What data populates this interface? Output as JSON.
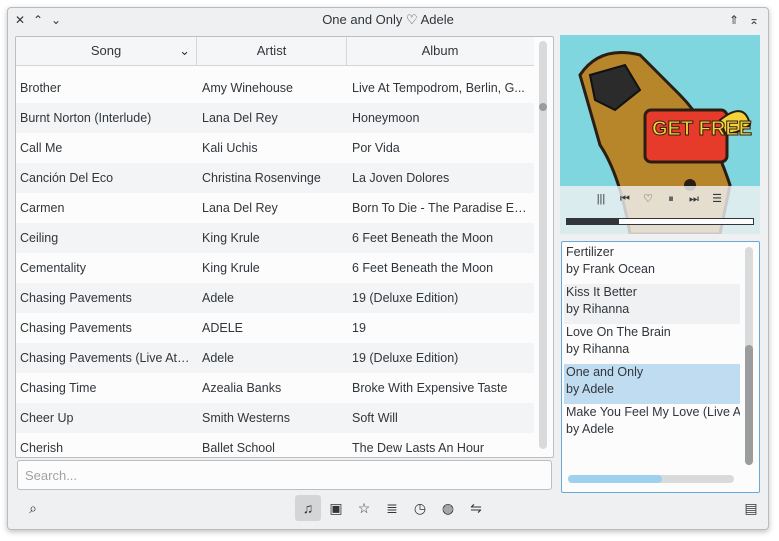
{
  "window": {
    "title": "One and Only ♡ Adele"
  },
  "titlebar": {
    "close": "✕",
    "up": "⌃",
    "down": "⌄",
    "keep_above": "⇑",
    "minimize_up": "⌅"
  },
  "table": {
    "columns": [
      "Song",
      "Artist",
      "Album"
    ],
    "sort_indicator": "⌄",
    "rows": [
      {
        "song": "Brother",
        "artist": "Amy Winehouse",
        "album": "Live At Tempodrom, Berlin, G..."
      },
      {
        "song": "Burnt Norton (Interlude)",
        "artist": "Lana Del Rey",
        "album": "Honeymoon"
      },
      {
        "song": "Call Me",
        "artist": "Kali Uchis",
        "album": "Por Vida"
      },
      {
        "song": "Canción Del Eco",
        "artist": "Christina Rosenvinge",
        "album": "La Joven Dolores"
      },
      {
        "song": "Carmen",
        "artist": "Lana Del Rey",
        "album": "Born To Die - The Paradise Ed..."
      },
      {
        "song": "Ceiling",
        "artist": "King Krule",
        "album": "6 Feet Beneath the Moon"
      },
      {
        "song": "Cementality",
        "artist": "King Krule",
        "album": "6 Feet Beneath the Moon"
      },
      {
        "song": "Chasing Pavements",
        "artist": "Adele",
        "album": "19 (Deluxe Edition)"
      },
      {
        "song": "Chasing Pavements",
        "artist": "ADELE",
        "album": "19"
      },
      {
        "song": "Chasing Pavements (Live At ...",
        "artist": "Adele",
        "album": "19 (Deluxe Edition)"
      },
      {
        "song": "Chasing Time",
        "artist": "Azealia Banks",
        "album": "Broke With Expensive Taste"
      },
      {
        "song": "Cheer Up",
        "artist": "Smith Westerns",
        "album": "Soft Will"
      },
      {
        "song": "Cherish",
        "artist": "Ballet School",
        "album": "The Dew Lasts An Hour"
      }
    ]
  },
  "search": {
    "placeholder": "Search..."
  },
  "bottom_bar": {
    "search_icon": "⌕",
    "music_icon": "♫",
    "album_icon": "▣",
    "star_icon": "☆",
    "playlist_icon": "≣",
    "history_icon": "◷",
    "globe_icon": "◍",
    "settings_icon": "⇋",
    "notes_icon": "▤"
  },
  "player": {
    "art_text": "GET FREE",
    "progress": 0.28,
    "controls": {
      "visualizer": "|||",
      "prev": "⏮",
      "love": "♡",
      "pause": "⏸",
      "next": "⏭",
      "queue": "☰"
    }
  },
  "playlist": {
    "items": [
      {
        "title": "Fertilizer",
        "artist": "by Frank Ocean"
      },
      {
        "title": "Kiss It Better",
        "artist": "by Rihanna"
      },
      {
        "title": "Love On The Brain",
        "artist": "by Rihanna"
      },
      {
        "title": "One and Only",
        "artist": "by Adele"
      },
      {
        "title": "Make You Feel My Love (Live At",
        "artist": "by Adele"
      }
    ],
    "selected_index": 3
  },
  "colors": {
    "selection": "#bfdcf0",
    "accent": "#3daee9",
    "art_bg": "#7fd6df"
  }
}
